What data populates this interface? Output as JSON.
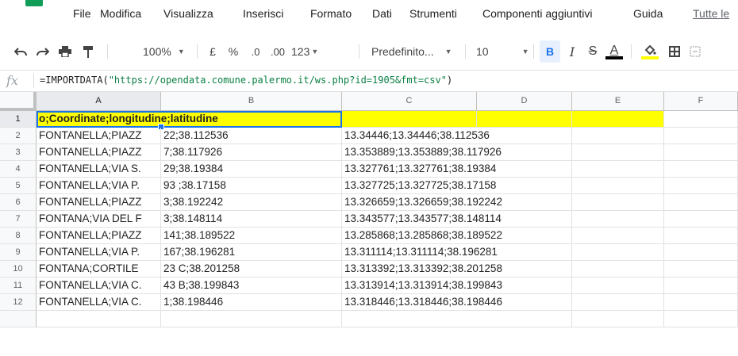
{
  "menu": {
    "items": [
      "File",
      "Modifica",
      "Visualizza",
      "Inserisci",
      "Formato",
      "Dati",
      "Strumenti",
      "Componenti aggiuntivi",
      "Guida"
    ],
    "last_edit_link": "Tutte le"
  },
  "toolbar": {
    "zoom": "100%",
    "currency": "£",
    "percent": "%",
    "decimal_decrease": ".0",
    "decimal_increase": ".00",
    "number_format": "123",
    "font": "Predefinito...",
    "font_size": "10",
    "bold": "B",
    "italic": "I",
    "strikethrough": "S",
    "text_color": "A"
  },
  "formula_bar": {
    "fx": "fx",
    "prefix": "=IMPORTDATA(",
    "string": "\"https://opendata.comune.palermo.it/ws.php?id=1905&fmt=csv\"",
    "suffix": ")"
  },
  "columns": [
    "A",
    "B",
    "C",
    "D",
    "E",
    "F"
  ],
  "rows": [
    {
      "num": "1",
      "a": "o;Coordinate;longitudine;latitudine",
      "c": ""
    },
    {
      "num": "2",
      "a": "FONTANELLA;PIAZZ",
      "b": "22;38.112536",
      "c": "13.34446;13.34446;38.112536"
    },
    {
      "num": "3",
      "a": "FONTANELLA;PIAZZ",
      "b": "7;38.117926",
      "c": "13.353889;13.353889;38.117926"
    },
    {
      "num": "4",
      "a": "FONTANELLA;VIA S.",
      "b": "29;38.19384",
      "c": "13.327761;13.327761;38.19384"
    },
    {
      "num": "5",
      "a": "FONTANELLA;VIA P.",
      "b": "93 ;38.17158",
      "c": "13.327725;13.327725;38.17158"
    },
    {
      "num": "6",
      "a": "FONTANELLA;PIAZZ",
      "b": "3;38.192242",
      "c": "13.326659;13.326659;38.192242"
    },
    {
      "num": "7",
      "a": "FONTANA;VIA DEL F",
      "b": "3;38.148114",
      "c": "13.343577;13.343577;38.148114"
    },
    {
      "num": "8",
      "a": "FONTANELLA;PIAZZ",
      "b": "141;38.189522",
      "c": "13.285868;13.285868;38.189522"
    },
    {
      "num": "9",
      "a": "FONTANELLA;VIA P.",
      "b": "167;38.196281",
      "c": "13.311114;13.311114;38.196281"
    },
    {
      "num": "10",
      "a": "FONTANA;CORTILE",
      "b": "23 C;38.201258",
      "c": "13.313392;13.313392;38.201258"
    },
    {
      "num": "11",
      "a": "FONTANELLA;VIA C.",
      "b": "43 B;38.199843",
      "c": "13.313914;13.313914;38.199843"
    },
    {
      "num": "12",
      "a": "FONTANELLA;VIA C.",
      "b": "1;38.198446",
      "c": "13.318446;13.318446;38.198446"
    }
  ],
  "colors": {
    "header_fill": "#ffff00",
    "selection": "#1a73e8"
  }
}
